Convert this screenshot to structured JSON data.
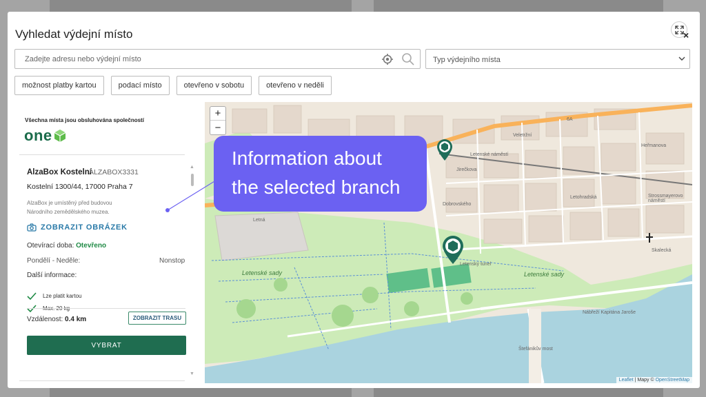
{
  "modal": {
    "title": "Vyhledat výdejní místo",
    "close_symbol": "×"
  },
  "search": {
    "placeholder": "Zadejte adresu nebo výdejní místo",
    "value": ""
  },
  "type_select": {
    "placeholder": "Typ výdejního místa"
  },
  "filters": [
    "možnost platby kartou",
    "podací místo",
    "otevřeno v sobotu",
    "otevřeno v neděli"
  ],
  "sidebar": {
    "operator_note": "Všechna místa jsou obsluhována společností",
    "operator_logo": "one",
    "branch": {
      "name": "AlzaBox Kostelní",
      "code": "ALZABOX3331",
      "address": "Kostelní 1300/44, 17000 Praha 7",
      "description": "AlzaBox je umístěný před budovou Národního zemědělského muzea.",
      "photo_link": "ZOBRAZIT OBRÁZEK",
      "hours_label": "Otevírací doba:",
      "hours_status": "Otevřeno",
      "hours_days": "Pondělí - Neděle:",
      "hours_value": "Nonstop",
      "info_label": "Další informace:",
      "info_items": [
        "Lze platit kartou",
        "Max. 20 kg"
      ],
      "distance_label": "Vzdálenost:",
      "distance_value": "0.4 km",
      "route_button": "ZOBRAZIT TRASU",
      "select_button": "VYBRAT"
    }
  },
  "map": {
    "zoom_in": "+",
    "zoom_out": "−",
    "attribution_leaflet": "Leaflet",
    "attribution_sep": " | Mapy © ",
    "attribution_osm": "OpenStreetMap",
    "labels": {
      "letenske_sady_1": "Letenské sady",
      "letenske_sady_2": "Letenské sady",
      "letenske_namesti": "Letenské náměstí",
      "veletrzni": "Veletržní",
      "jirovcova": "Jirečkova",
      "dobrovskeho": "Dobrovského",
      "letohradska": "Letohradská",
      "stefanikuv_most": "Štefánikův most",
      "nabrezi": "Nábřeží Kapitána Jaroše",
      "letenska": "Letenský tunel",
      "letna": "Letná",
      "hermanova": "Heřmanova",
      "strossmayer": "Strossmayerovo náměstí",
      "skalecka": "Skalecká",
      "code_6a": "6A"
    }
  },
  "callout": {
    "line1": "Information about",
    "line2": "the selected branch",
    "color": "#6b61f2"
  },
  "colors": {
    "brand_green": "#1f6d50",
    "link_blue": "#2a7aa8",
    "open_green": "#1f8a45"
  }
}
